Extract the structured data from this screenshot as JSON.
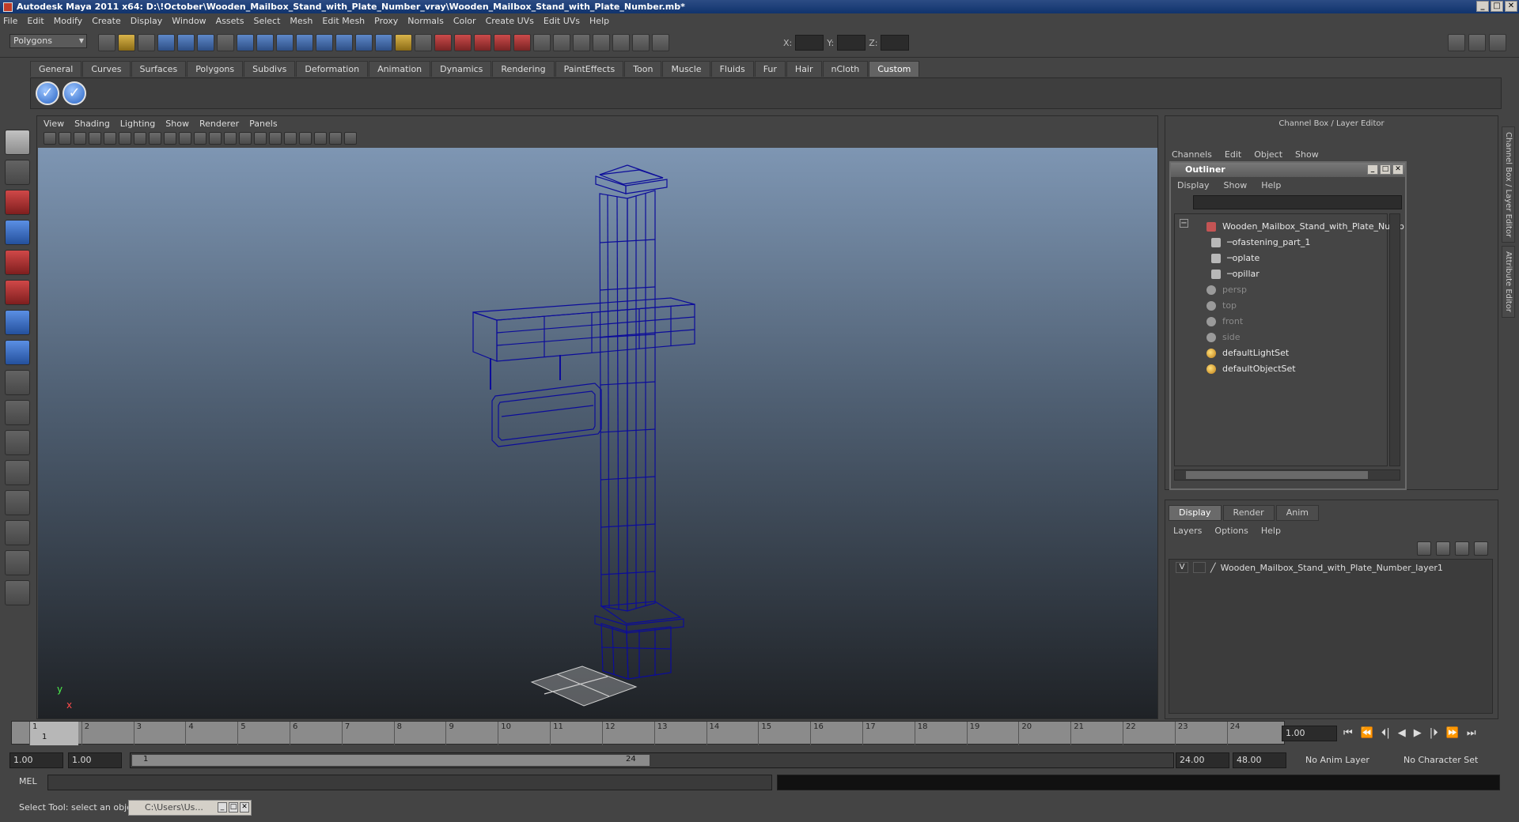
{
  "window": {
    "title": "Autodesk Maya 2011 x64: D:\\!October\\Wooden_Mailbox_Stand_with_Plate_Number_vray\\Wooden_Mailbox_Stand_with_Plate_Number.mb*",
    "controls": [
      "_",
      "□",
      "✕"
    ]
  },
  "menubar": [
    "File",
    "Edit",
    "Modify",
    "Create",
    "Display",
    "Window",
    "Assets",
    "Select",
    "Mesh",
    "Edit Mesh",
    "Proxy",
    "Normals",
    "Color",
    "Create UVs",
    "Edit UVs",
    "Help"
  ],
  "statusline": {
    "mode": "Polygons",
    "x_label": "X:",
    "y_label": "Y:",
    "z_label": "Z:"
  },
  "shelf": {
    "tabs": [
      "General",
      "Curves",
      "Surfaces",
      "Polygons",
      "Subdivs",
      "Deformation",
      "Animation",
      "Dynamics",
      "Rendering",
      "PaintEffects",
      "Toon",
      "Muscle",
      "Fluids",
      "Fur",
      "Hair",
      "nCloth",
      "Custom"
    ],
    "active_tab": "Custom",
    "buttons": [
      "✓",
      "✓"
    ]
  },
  "viewport": {
    "menu": [
      "View",
      "Shading",
      "Lighting",
      "Show",
      "Renderer",
      "Panels"
    ],
    "axis_y": "y",
    "axis_x": "x",
    "wire_color": "#0c0c9a"
  },
  "channel_box": {
    "title": "Channel Box / Layer Editor",
    "menu": [
      "Channels",
      "Edit",
      "Object",
      "Show"
    ]
  },
  "outliner": {
    "title": "Outliner",
    "menu": [
      "Display",
      "Show",
      "Help"
    ],
    "items": [
      {
        "label": "Wooden_Mailbox_Stand_with_Plate_Numb",
        "indent": 0,
        "style": "hl",
        "icon": "group-icon"
      },
      {
        "label": "fastening_part_1",
        "indent": 1,
        "style": "hl",
        "icon": "mesh-icon"
      },
      {
        "label": "plate",
        "indent": 1,
        "style": "hl",
        "icon": "mesh-icon"
      },
      {
        "label": "pillar",
        "indent": 1,
        "style": "hl",
        "icon": "mesh-icon"
      },
      {
        "label": "persp",
        "indent": 0,
        "style": "dim",
        "icon": "camera-icon"
      },
      {
        "label": "top",
        "indent": 0,
        "style": "dim",
        "icon": "camera-icon"
      },
      {
        "label": "front",
        "indent": 0,
        "style": "dim",
        "icon": "camera-icon"
      },
      {
        "label": "side",
        "indent": 0,
        "style": "dim",
        "icon": "camera-icon"
      },
      {
        "label": "defaultLightSet",
        "indent": 0,
        "style": "hl",
        "icon": "set-icon"
      },
      {
        "label": "defaultObjectSet",
        "indent": 0,
        "style": "hl",
        "icon": "set-icon"
      }
    ]
  },
  "layer_editor": {
    "tabs": [
      "Display",
      "Render",
      "Anim"
    ],
    "active_tab": "Display",
    "menu": [
      "Layers",
      "Options",
      "Help"
    ],
    "layers": [
      {
        "visible": "V",
        "name": "Wooden_Mailbox_Stand_with_Plate_Number_layer1"
      }
    ]
  },
  "side_tabs": [
    "Channel Box / Layer Editor",
    "Attribute Editor"
  ],
  "timeline": {
    "ticks": [
      "1",
      "2",
      "3",
      "4",
      "5",
      "6",
      "7",
      "8",
      "9",
      "10",
      "11",
      "12",
      "13",
      "14",
      "15",
      "16",
      "17",
      "18",
      "19",
      "20",
      "21",
      "22",
      "23",
      "24"
    ],
    "current_frame": "1",
    "current_time_field": "1.00",
    "playback_buttons": [
      "⏮",
      "⏪",
      "⏴|",
      "◀",
      "▶",
      "|⏵",
      "⏩",
      "⏭"
    ]
  },
  "range": {
    "start_time": "1.00",
    "playback_start": "1.00",
    "slider_start": "1",
    "slider_end": "24",
    "playback_end": "24.00",
    "end_time": "48.00",
    "anim_layer": "No Anim Layer",
    "character_set": "No Character Set"
  },
  "command_line": {
    "label": "MEL"
  },
  "help_line": {
    "text": "Select Tool: select an object",
    "task_title": "C:\\Users\\Us..."
  }
}
